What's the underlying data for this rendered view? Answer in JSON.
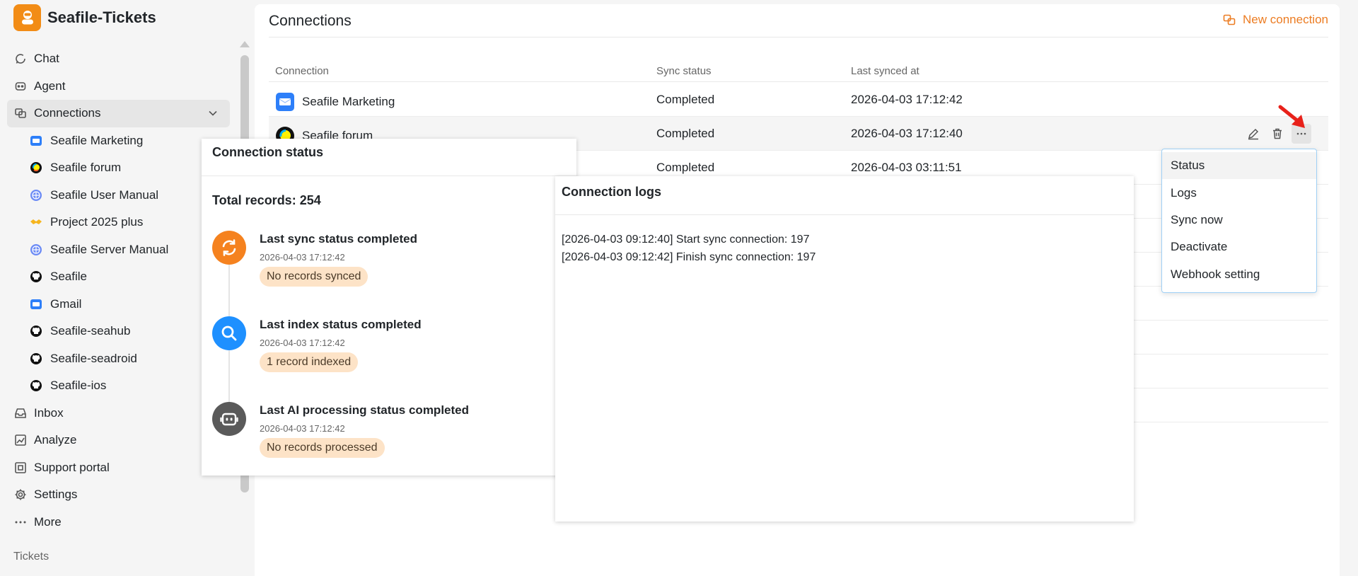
{
  "app": {
    "name": "Seafile-Tickets"
  },
  "sidebar": {
    "nav": [
      {
        "label": "Chat",
        "icon": "chat-icon"
      },
      {
        "label": "Agent",
        "icon": "robot-icon"
      },
      {
        "label": "Connections",
        "icon": "connections-icon",
        "active": true
      }
    ],
    "connections": [
      {
        "label": "Seafile Marketing",
        "icon": "mail-icon"
      },
      {
        "label": "Seafile forum",
        "icon": "discourse-icon"
      },
      {
        "label": "Seafile User Manual",
        "icon": "globe-icon"
      },
      {
        "label": "Project 2025 plus",
        "icon": "handshake-icon"
      },
      {
        "label": "Seafile Server Manual",
        "icon": "globe-icon"
      },
      {
        "label": "Seafile",
        "icon": "github-icon"
      },
      {
        "label": "Gmail",
        "icon": "mail-icon"
      },
      {
        "label": "Seafile-seahub",
        "icon": "github-icon"
      },
      {
        "label": "Seafile-seadroid",
        "icon": "github-icon"
      },
      {
        "label": "Seafile-ios",
        "icon": "github-icon"
      }
    ],
    "nav_bottom": [
      {
        "label": "Inbox",
        "icon": "inbox-icon"
      },
      {
        "label": "Analyze",
        "icon": "chart-icon"
      },
      {
        "label": "Support portal",
        "icon": "portal-icon"
      },
      {
        "label": "Settings",
        "icon": "gear-icon"
      },
      {
        "label": "More",
        "icon": "ellipsis-icon"
      }
    ],
    "section_label": "Tickets"
  },
  "main": {
    "title": "Connections",
    "new_button": "New connection",
    "columns": [
      "Connection",
      "Sync status",
      "Last synced at"
    ],
    "rows": [
      {
        "name": "Seafile Marketing",
        "status": "Completed",
        "synced": "2026-04-03 17:12:42",
        "icon": "mail-icon"
      },
      {
        "name": "Seafile forum",
        "status": "Completed",
        "synced": "2026-04-03 17:12:40",
        "icon": "discourse-icon"
      },
      {
        "name": "",
        "status": "Completed",
        "synced": "2026-04-03 03:11:51",
        "icon": ""
      }
    ]
  },
  "dropdown": {
    "items": [
      "Status",
      "Logs",
      "Sync now",
      "Deactivate",
      "Webhook setting"
    ]
  },
  "status_panel": {
    "title": "Connection status",
    "total": "Total records: 254",
    "steps": [
      {
        "title": "Last sync status completed",
        "time": "2026-04-03 17:12:42",
        "badge": "No records synced",
        "icon": "sync-icon",
        "color": "#f5821f"
      },
      {
        "title": "Last index status completed",
        "time": "2026-04-03 17:12:42",
        "badge": "1 record indexed",
        "icon": "search-icon",
        "color": "#1e90ff"
      },
      {
        "title": "Last AI processing status completed",
        "time": "2026-04-03 17:12:42",
        "badge": "No records processed",
        "icon": "robot-icon",
        "color": "#5a5a5a"
      }
    ]
  },
  "logs_panel": {
    "title": "Connection logs",
    "lines": [
      "[2026-04-03 09:12:40] Start sync connection: 197",
      "[2026-04-03 09:12:42] Finish sync connection: 197"
    ]
  }
}
